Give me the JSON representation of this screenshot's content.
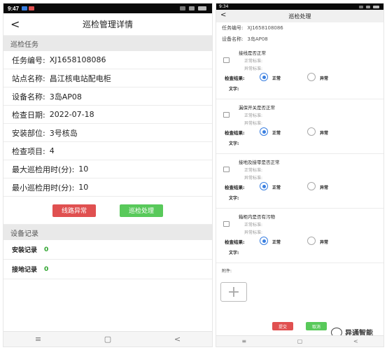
{
  "left": {
    "status": {
      "time": "9:47"
    },
    "nav": {
      "back": "<",
      "title": "巡检管理详情"
    },
    "section_task": "巡检任务",
    "fields": [
      {
        "label": "任务编号:",
        "value": "XJ1658108086"
      },
      {
        "label": "站点名称:",
        "value": "昌江核电站配电柜"
      },
      {
        "label": "设备名称:",
        "value": "3岛AP08"
      },
      {
        "label": "检查日期:",
        "value": "2022-07-18"
      },
      {
        "label": "安装部位:",
        "value": "3号核岛"
      },
      {
        "label": "检查项目:",
        "value": "4"
      },
      {
        "label": "最大巡检用时(分):",
        "value": "10"
      },
      {
        "label": "最小巡检用时(分):",
        "value": "10"
      }
    ],
    "buttons": {
      "line_abnormal": "线路异常",
      "inspect_handle": "巡检处理"
    },
    "section_records": "设备记录",
    "records": [
      {
        "label": "安装记录",
        "count": "0"
      },
      {
        "label": "接地记录",
        "count": "0"
      }
    ],
    "navbar": {
      "menu": "≡",
      "home": "▢",
      "back": "<"
    }
  },
  "right": {
    "status": {
      "time": "9:34"
    },
    "nav": {
      "back": "<",
      "title": "巡检处理"
    },
    "task_no_label": "任务编号:",
    "task_no": "XJ1658108086",
    "device_label": "设备名称:",
    "device": "3岛AP08",
    "items": [
      {
        "title": "接线是否正常",
        "normal_std": "正常标准:",
        "abnormal_std": "异常标准:",
        "result_label": "检查结果:",
        "opt_normal": "正常",
        "opt_abnormal": "异常",
        "text_label": "文字:"
      },
      {
        "title": "漏保开关是否正常",
        "normal_std": "正常标准:",
        "abnormal_std": "异常标准:",
        "result_label": "检查结果:",
        "opt_normal": "正常",
        "opt_abnormal": "异常",
        "text_label": "文字:"
      },
      {
        "title": "接地及接零是否正常",
        "normal_std": "正常标准:",
        "abnormal_std": "异常标准:",
        "result_label": "检查结果:",
        "opt_normal": "正常",
        "opt_abnormal": "异常",
        "text_label": "文字:"
      },
      {
        "title": "箱柜内是否有污物",
        "normal_std": "正常标准:",
        "abnormal_std": "异常标准:",
        "result_label": "检查结果:",
        "opt_normal": "正常",
        "opt_abnormal": "异常",
        "text_label": "文字:"
      }
    ],
    "attach_label": "附件:",
    "add": "+",
    "submit": "提交",
    "cancel": "取消",
    "watermark": "异通智能",
    "navbar": {
      "menu": "≡",
      "home": "▢",
      "back": "<"
    }
  },
  "colors": {
    "red": "#e05050",
    "green": "#58c95a",
    "blue": "#3a7fe0"
  }
}
